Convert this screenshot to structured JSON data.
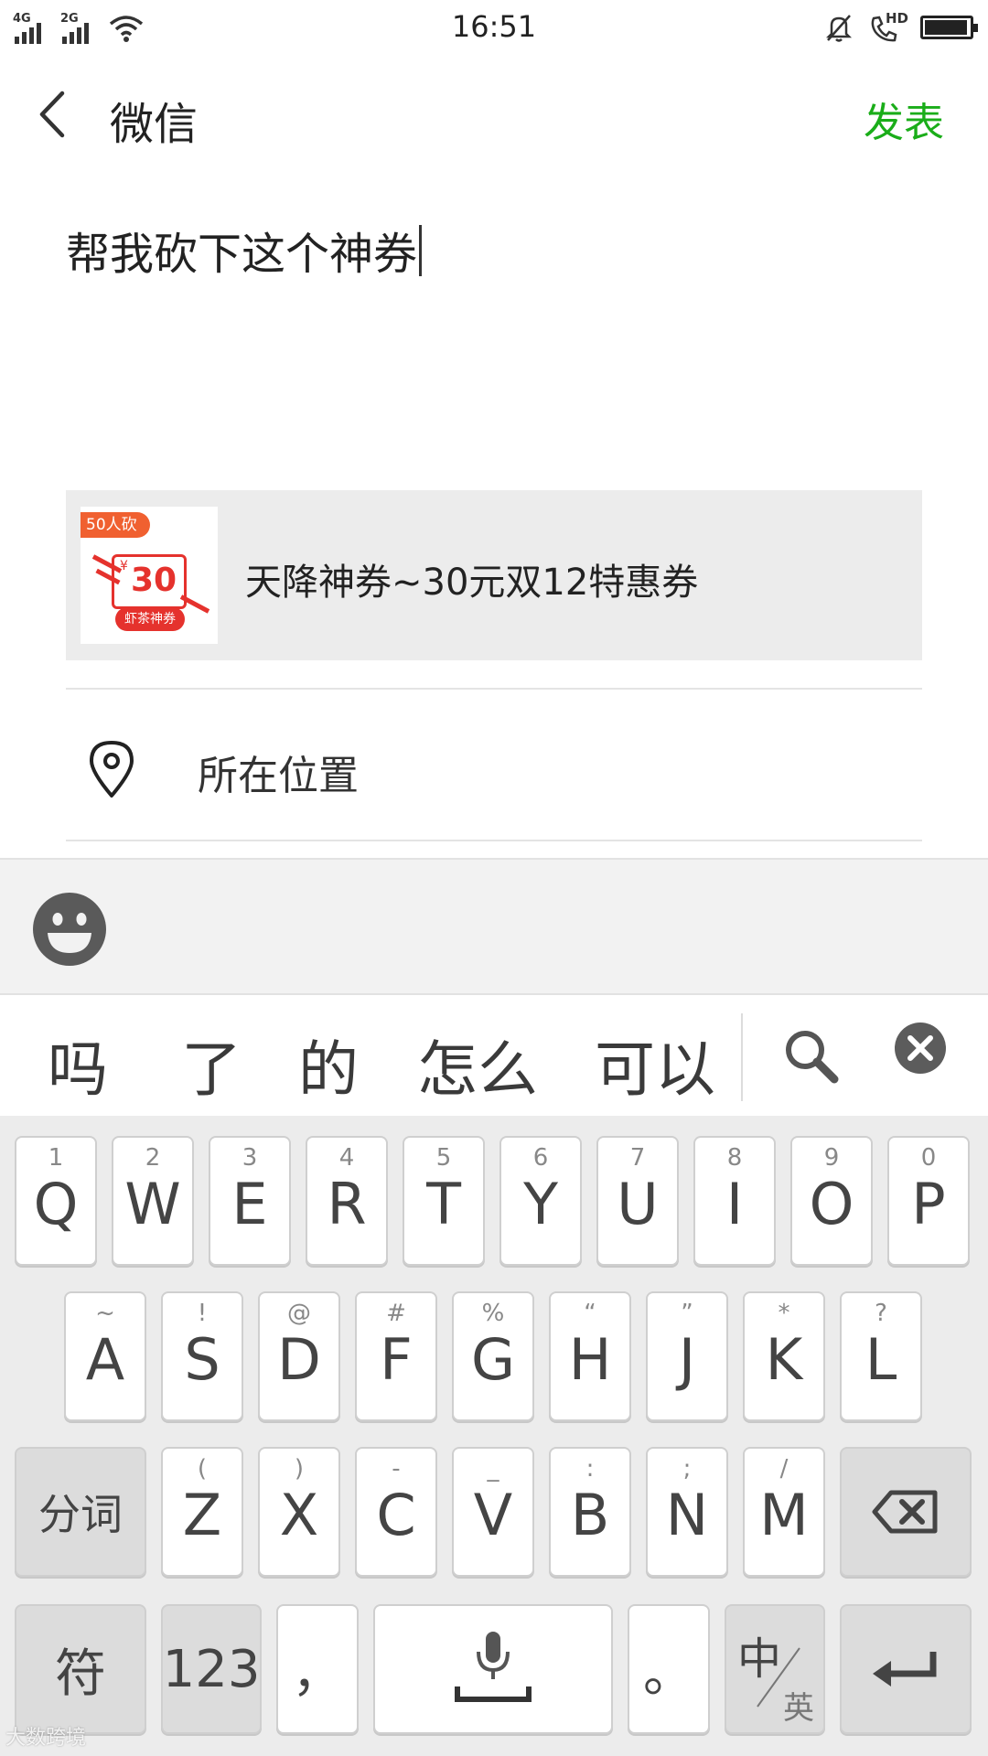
{
  "status_bar": {
    "network1": "4G",
    "network2": "2G",
    "time": "16:51",
    "hd_label": "HD",
    "battery_level": 0.95
  },
  "header": {
    "title": "微信",
    "publish_label": "发表"
  },
  "post": {
    "text": "帮我砍下这个神券"
  },
  "share_card": {
    "tag": "50人砍",
    "currency": "¥",
    "value": "30",
    "ribbon": "虾茶神券",
    "title": "天降神券~30元双12特惠券"
  },
  "location": {
    "label": "所在位置"
  },
  "candidates": [
    "吗",
    "了",
    "的",
    "怎么",
    "可以"
  ],
  "keyboard": {
    "row1": [
      {
        "hint": "1",
        "key": "Q"
      },
      {
        "hint": "2",
        "key": "W"
      },
      {
        "hint": "3",
        "key": "E"
      },
      {
        "hint": "4",
        "key": "R"
      },
      {
        "hint": "5",
        "key": "T"
      },
      {
        "hint": "6",
        "key": "Y"
      },
      {
        "hint": "7",
        "key": "U"
      },
      {
        "hint": "8",
        "key": "I"
      },
      {
        "hint": "9",
        "key": "O"
      },
      {
        "hint": "0",
        "key": "P"
      }
    ],
    "row2": [
      {
        "hint": "~",
        "key": "A"
      },
      {
        "hint": "!",
        "key": "S"
      },
      {
        "hint": "@",
        "key": "D"
      },
      {
        "hint": "#",
        "key": "F"
      },
      {
        "hint": "%",
        "key": "G"
      },
      {
        "hint": "“",
        "key": "H"
      },
      {
        "hint": "”",
        "key": "J"
      },
      {
        "hint": "*",
        "key": "K"
      },
      {
        "hint": "?",
        "key": "L"
      }
    ],
    "row3": [
      {
        "hint": "(",
        "key": "Z"
      },
      {
        "hint": ")",
        "key": "X"
      },
      {
        "hint": "-",
        "key": "C"
      },
      {
        "hint": "_",
        "key": "V"
      },
      {
        "hint": ":",
        "key": "B"
      },
      {
        "hint": ";",
        "key": "N"
      },
      {
        "hint": "/",
        "key": "M"
      }
    ],
    "segment_label": "分词",
    "symbol_label": "符",
    "numeric_label": "123",
    "comma_label": "，",
    "period_label": "。",
    "lang_zh": "中",
    "lang_en": "英"
  },
  "watermark": "大数跨境",
  "colors": {
    "accent_green": "#1aad19",
    "coupon_red": "#e5322d",
    "coupon_orange": "#f06030"
  }
}
